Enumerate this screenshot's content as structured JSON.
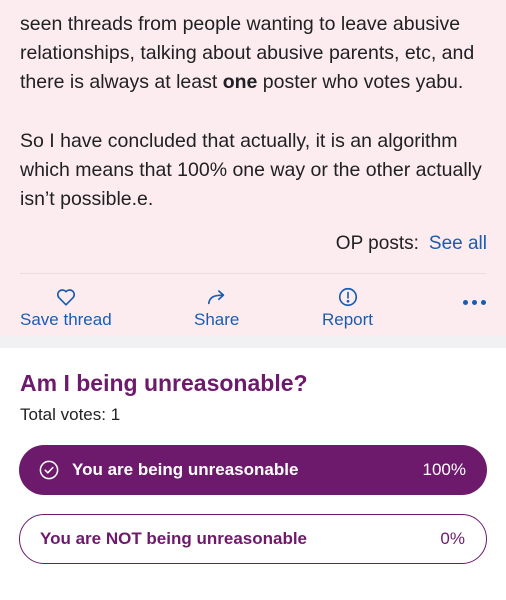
{
  "post": {
    "paragraph1": {
      "before": "seen threads from people wanting to leave abusive relationships, talking about abusive parents, etc, and there is always at least ",
      "bold": "one",
      "after": " poster who votes yabu."
    },
    "paragraph2": "So I have concluded that actually, it is an algorithm which means that 100% one way or the other actually isn’t possible.e.",
    "op_posts_label": "OP posts:",
    "see_all_label": "See all"
  },
  "actions": {
    "save_label": "Save thread",
    "share_label": "Share",
    "report_label": "Report",
    "more_icon": "ellipsis-icon"
  },
  "poll": {
    "title": "Am I being unreasonable?",
    "total_votes": "Total votes: 1",
    "options": [
      {
        "label": "You are being unreasonable",
        "percent": "100%",
        "selected": true
      },
      {
        "label": "You are NOT being unreasonable",
        "percent": "0%",
        "selected": false
      }
    ]
  },
  "colors": {
    "post_background": "#fdecef",
    "link_blue": "#1a5cb0",
    "brand_purple": "#6d1a6c"
  }
}
